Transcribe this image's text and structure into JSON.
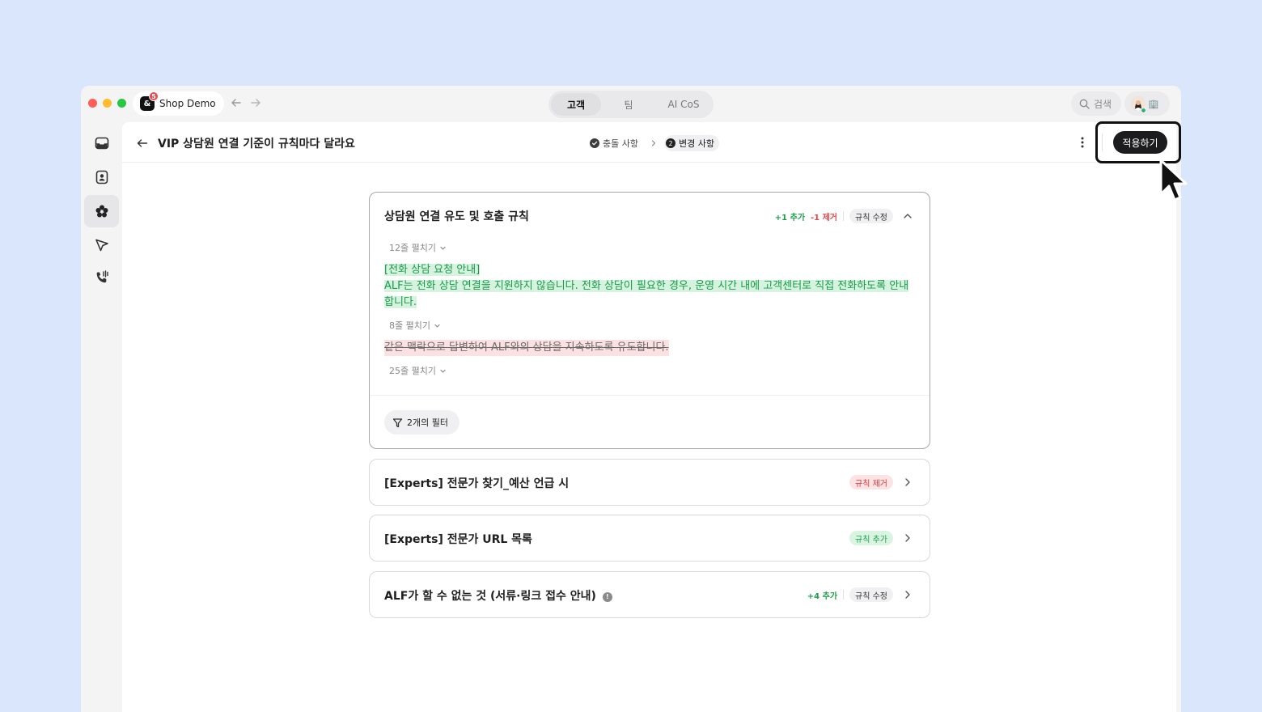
{
  "window": {
    "traffic_lights": [
      "#ff5f57",
      "#febc2e",
      "#28c840"
    ],
    "workspace": {
      "name": "Shop Demo",
      "logo": "&",
      "badge": "5"
    },
    "tabs": [
      {
        "label": "고객",
        "active": true
      },
      {
        "label": "팀",
        "active": false
      },
      {
        "label": "AI CoS",
        "active": false
      }
    ],
    "search_label": "검색",
    "avatar_extra": "🏢"
  },
  "sidebar": {
    "items": [
      {
        "name": "inbox-icon",
        "active": false
      },
      {
        "name": "contacts-icon",
        "active": false
      },
      {
        "name": "ai-agent-icon",
        "active": true
      },
      {
        "name": "campaign-icon",
        "active": false
      },
      {
        "name": "phone-icon",
        "active": false
      }
    ]
  },
  "header": {
    "title": "VIP 상담원 연결 기준이 규칙마다 달라요",
    "steps": [
      {
        "label": "충돌 사항",
        "state": "done"
      },
      {
        "label": "변경 사항",
        "state": "active",
        "number": "2"
      }
    ],
    "apply_label": "적용하기"
  },
  "cards": {
    "expanded": {
      "title": "상담원 연결 유도 및 호출 규칙",
      "added": "+1 추가",
      "removed": "-1 제거",
      "tag": "규칙 수정",
      "expand_1": "12줄 펼치기",
      "added_lines": [
        "[전화 상담 요청 안내]",
        "ALF는 전화 상담 연결을 지원하지 않습니다. 전화 상담이 필요한 경우, 운영 시간 내에 고객센터로 직접 전화하도록 안내합니다."
      ],
      "expand_2": "8줄 펼치기",
      "removed_line": "같은 맥락으로 답변하여 ALF와의 상담을 지속하도록 유도합니다.",
      "expand_3": "25줄 펼치기",
      "filter_label": "2개의 필터"
    },
    "collapsed": [
      {
        "title": "[Experts] 전문가 찾기_예산 언급 시",
        "tag": "규칙 제거",
        "tag_color": "red"
      },
      {
        "title": "[Experts] 전문가 URL 목록",
        "tag": "규칙 추가",
        "tag_color": "green"
      },
      {
        "title": "ALF가 할 수 없는 것 (서류·링크 접수 안내)",
        "info": "!",
        "added": "+4 추가",
        "tag": "규칙 수정",
        "tag_color": "gray"
      }
    ]
  },
  "colors": {
    "background": "#d9e6fc",
    "accent_dark": "#1c1c1e",
    "add_green": "#1e9e4b",
    "remove_red": "#e5484d"
  }
}
